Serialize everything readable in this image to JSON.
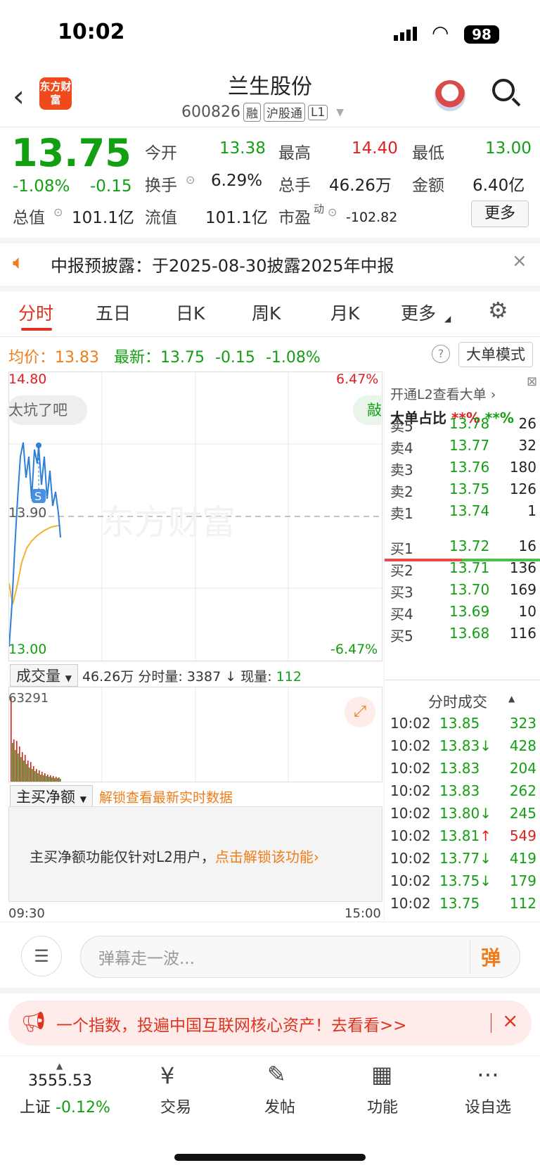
{
  "status_bar": {
    "time": "10:02",
    "battery": "98"
  },
  "header": {
    "logo_text": "东方财富",
    "stock_name": "兰生股份",
    "stock_code": "600826",
    "tags": [
      "融",
      "沪股通",
      "L1"
    ]
  },
  "quote": {
    "price": "13.75",
    "change_pct": "-1.08%",
    "change": "-0.15",
    "fields": [
      {
        "label": "今开",
        "value": "13.38",
        "color": "green"
      },
      {
        "label": "最高",
        "value": "14.40",
        "color": "red"
      },
      {
        "label": "最低",
        "value": "13.00",
        "color": "green"
      },
      {
        "label": "换手",
        "value": "6.29%",
        "color": "black"
      },
      {
        "label": "总手",
        "value": "46.26万",
        "color": "black"
      },
      {
        "label": "金额",
        "value": "6.40亿",
        "color": "black"
      },
      {
        "label": "总值",
        "value": "101.1亿",
        "color": "black"
      },
      {
        "label": "流值",
        "value": "101.1亿",
        "color": "black"
      },
      {
        "label": "市盈",
        "value": "-102.82",
        "color": "black"
      }
    ],
    "pe_superscript": "动",
    "more_label": "更多"
  },
  "notice": {
    "text": "中报预披露：于2025-08-30披露2025年中报"
  },
  "tabs": [
    "分时",
    "五日",
    "日K",
    "周K",
    "月K",
    "更多"
  ],
  "avg_row": {
    "avg_label": "均价：",
    "avg_value": "13.83",
    "latest_label": "最新：",
    "latest_value": "13.75",
    "change": "-0.15",
    "change_pct": "-1.08%",
    "help": "?",
    "mode_label": "大单模式"
  },
  "chart": {
    "y_top": "14.80",
    "y_mid": "13.90",
    "y_bottom": "13.00",
    "pct_top": "6.47%",
    "pct_bottom": "-6.47%",
    "bubble_left": "太坑了吧",
    "bubble_right": "敲",
    "marker": "S",
    "watermark": "东方财富"
  },
  "volume": {
    "dropdown_label": "成交量",
    "summary": "46.26万 分时量: 3387 ↓ 现量: ",
    "current_vol": "112",
    "max_label": "63291"
  },
  "net_buy": {
    "dropdown_label": "主买净额",
    "unlock_link": "解锁查看最新实时数据",
    "info_text": "主买净额功能仅针对L2用户，",
    "info_link": "点击解锁该功能›",
    "time_start": "09:30",
    "time_end": "15:00"
  },
  "order_book": {
    "promo": "开通L2查看大单 ›",
    "big_ratio_label": "大单占比",
    "big_ratio_red": "**%",
    "big_ratio_green": "**%",
    "asks": [
      {
        "label": "卖5",
        "price": "13.78",
        "vol": "26"
      },
      {
        "label": "卖4",
        "price": "13.77",
        "vol": "32"
      },
      {
        "label": "卖3",
        "price": "13.76",
        "vol": "180"
      },
      {
        "label": "卖2",
        "price": "13.75",
        "vol": "126"
      },
      {
        "label": "卖1",
        "price": "13.74",
        "vol": "1"
      }
    ],
    "bids": [
      {
        "label": "买1",
        "price": "13.72",
        "vol": "16"
      },
      {
        "label": "买2",
        "price": "13.71",
        "vol": "136"
      },
      {
        "label": "买3",
        "price": "13.70",
        "vol": "169"
      },
      {
        "label": "买4",
        "price": "13.69",
        "vol": "10"
      },
      {
        "label": "买5",
        "price": "13.68",
        "vol": "116"
      }
    ],
    "ticks_title": "分时成交",
    "ticks": [
      {
        "time": "10:02",
        "price": "13.85",
        "arrow": "",
        "vol": "323",
        "vol_color": "green"
      },
      {
        "time": "10:02",
        "price": "13.83",
        "arrow": "↓",
        "vol": "428",
        "vol_color": "green"
      },
      {
        "time": "10:02",
        "price": "13.83",
        "arrow": "",
        "vol": "204",
        "vol_color": "green"
      },
      {
        "time": "10:02",
        "price": "13.83",
        "arrow": "",
        "vol": "262",
        "vol_color": "green"
      },
      {
        "time": "10:02",
        "price": "13.80",
        "arrow": "↓",
        "vol": "245",
        "vol_color": "green"
      },
      {
        "time": "10:02",
        "price": "13.81",
        "arrow": "↑",
        "vol": "549",
        "vol_color": "red"
      },
      {
        "time": "10:02",
        "price": "13.77",
        "arrow": "↓",
        "vol": "419",
        "vol_color": "green"
      },
      {
        "time": "10:02",
        "price": "13.75",
        "arrow": "↓",
        "vol": "179",
        "vol_color": "green"
      },
      {
        "time": "10:02",
        "price": "13.75",
        "arrow": "",
        "vol": "112",
        "vol_color": "green"
      }
    ]
  },
  "danmu": {
    "placeholder": "弹幕走一波...",
    "send_label": "弹"
  },
  "ad": {
    "text": "一个指数，投遍中国互联网核心资产！去看看>>"
  },
  "tabbar": {
    "index_value": "3555.53",
    "index_name": "上证",
    "index_change": "-0.12%",
    "items": [
      "交易",
      "发帖",
      "功能",
      "设自选"
    ]
  },
  "colors": {
    "red": "#e02020",
    "green": "#12a012",
    "orange": "#f07d19",
    "avg_line": "#f2b233",
    "price_line": "#2d7fd8"
  }
}
